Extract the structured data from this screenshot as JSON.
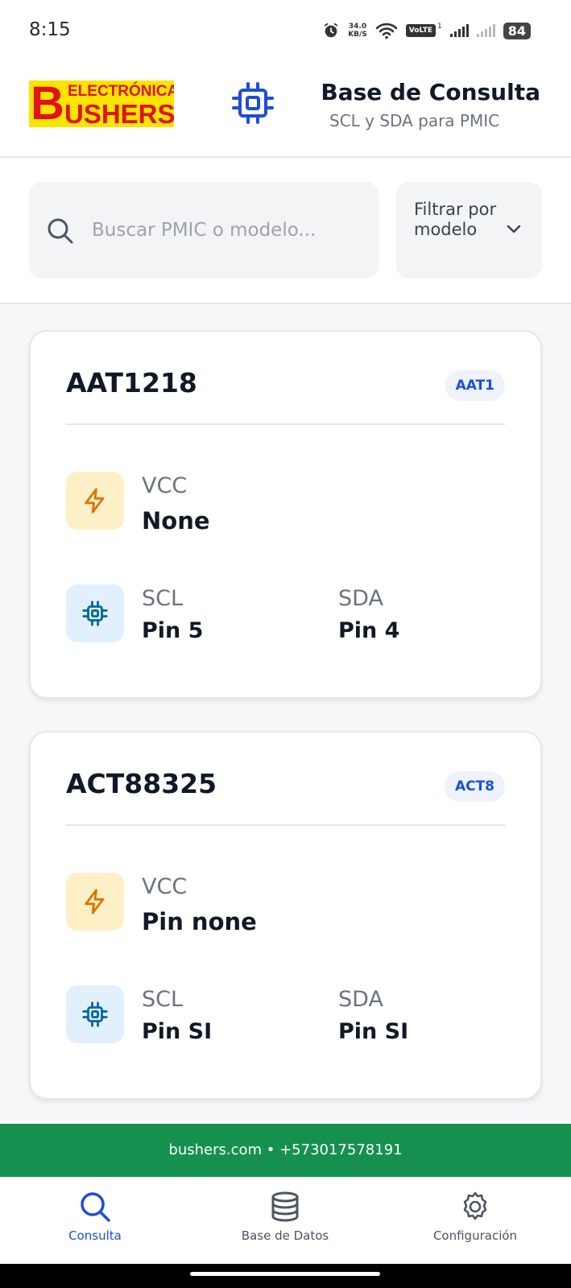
{
  "status_bar": {
    "time": "8:15",
    "net_speed_value": "34.0",
    "net_speed_unit": "KB/S",
    "volte": "VoLTE",
    "sim_index": "1",
    "battery": "84"
  },
  "header": {
    "logo_letter": "B",
    "logo_top": "ELECTRÓNICA",
    "logo_bottom": "USHERS",
    "title": "Base de Consulta",
    "subtitle": "SCL y SDA para PMIC"
  },
  "search": {
    "placeholder": "Buscar PMIC o modelo...",
    "value": ""
  },
  "filter": {
    "label": "Filtrar por modelo"
  },
  "cards": [
    {
      "name": "AAT1218",
      "badge": "AAT1",
      "vcc_label": "VCC",
      "vcc_value": "None",
      "scl_label": "SCL",
      "scl_value": "Pin 5",
      "sda_label": "SDA",
      "sda_value": "Pin 4"
    },
    {
      "name": "ACT88325",
      "badge": "ACT8",
      "vcc_label": "VCC",
      "vcc_value": "Pin none",
      "scl_label": "SCL",
      "scl_value": "Pin SI",
      "sda_label": "SDA",
      "sda_value": "Pin SI"
    }
  ],
  "footer": {
    "text": "bushers.com • +573017578191"
  },
  "nav": {
    "items": [
      {
        "label": "Consulta",
        "icon": "search-icon",
        "active": true
      },
      {
        "label": "Base de Datos",
        "icon": "database-icon",
        "active": false
      },
      {
        "label": "Configuración",
        "icon": "gear-icon",
        "active": false
      }
    ]
  },
  "colors": {
    "accent": "#1d4ed8",
    "footer_green": "#16904e",
    "logo_yellow": "#fbe400",
    "logo_red": "#e0121b",
    "vcc_tile": "#fdefc6",
    "chip_tile": "#e1f0fc"
  }
}
